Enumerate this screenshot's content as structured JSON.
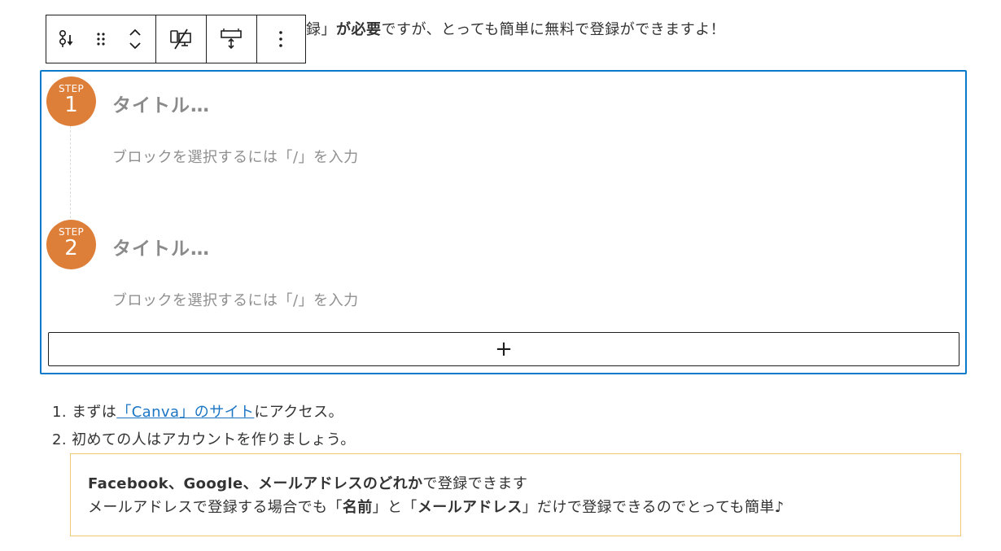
{
  "intro": {
    "part1": "録」",
    "bold": "が必要",
    "part2": "ですが、とっても簡単に無料で登録ができますよ！"
  },
  "toolbar": {
    "icons": [
      "step-block-icon",
      "drag-handle-icon",
      "move-up-icon",
      "move-down-icon",
      "hide-on-device-icon",
      "spacing-icon",
      "more-options-icon"
    ]
  },
  "steps": [
    {
      "label": "STEP",
      "number": "1",
      "title": "タイトル…",
      "placeholder": "ブロックを選択するには「/」を入力"
    },
    {
      "label": "STEP",
      "number": "2",
      "title": "タイトル…",
      "placeholder": "ブロックを選択するには「/」を入力"
    }
  ],
  "add_button": {
    "label": "+"
  },
  "list": [
    {
      "number": "1.",
      "before": "まずは",
      "link": "「Canva」のサイト",
      "after": "にアクセス。"
    },
    {
      "number": "2.",
      "text": "初めての人はアカウントを作りましょう。"
    }
  ],
  "note": {
    "line1_bold": "Facebook、Google、メールアドレスのどれか",
    "line1_rest": "で登録できます",
    "line2_a": "メールアドレスで登録する場合でも「",
    "line2_b": "名前",
    "line2_c": "」と「",
    "line2_d": "メールアドレス",
    "line2_e": "」だけで登録できるのでとっても簡単♪"
  },
  "colors": {
    "accent": "#0a7aca",
    "step": "#de7f39",
    "note_border": "#f2c776",
    "link": "#1a75c4"
  }
}
